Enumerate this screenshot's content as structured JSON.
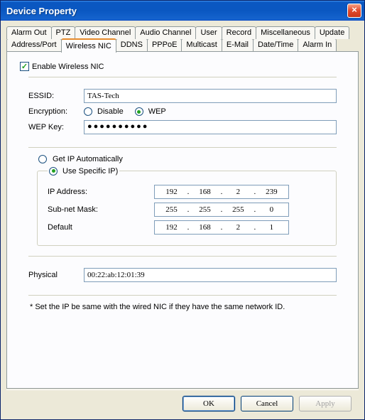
{
  "window": {
    "title": "Device Property",
    "close": "×"
  },
  "tabs_row1": [
    "Alarm Out",
    "PTZ",
    "Video Channel",
    "Audio Channel",
    "User",
    "Record",
    "Miscellaneous",
    "Update"
  ],
  "tabs_row2": [
    "Address/Port",
    "Wireless NIC",
    "DDNS",
    "PPPoE",
    "Multicast",
    "E-Mail",
    "Date/Time",
    "Alarm In"
  ],
  "active_tab": "Wireless NIC",
  "enable": {
    "label": "Enable Wireless NIC",
    "checked": true
  },
  "wifi": {
    "essid_label": "ESSID:",
    "essid_value": "TAS-Tech",
    "enc_label": "Encryption:",
    "opt_disable": "Disable",
    "opt_wep": "WEP",
    "enc_selected": "wep",
    "wepkey_label": "WEP Key:",
    "wepkey_value": "●●●●●●●●●●"
  },
  "ip": {
    "auto_label": "Get IP Automatically",
    "specific_label": "Use Specific IP)",
    "mode": "specific",
    "addr_label": "IP Address:",
    "mask_label": "Sub-net Mask:",
    "gw_label": "Default",
    "addr": [
      "192",
      "168",
      "2",
      "239"
    ],
    "mask": [
      "255",
      "255",
      "255",
      "0"
    ],
    "gw": [
      "192",
      "168",
      "2",
      "1"
    ]
  },
  "mac": {
    "label": "Physical",
    "value": "00:22:ab:12:01:39"
  },
  "note": "* Set the IP be same with the wired NIC if they have the same network ID.",
  "buttons": {
    "ok": "OK",
    "cancel": "Cancel",
    "apply": "Apply"
  }
}
